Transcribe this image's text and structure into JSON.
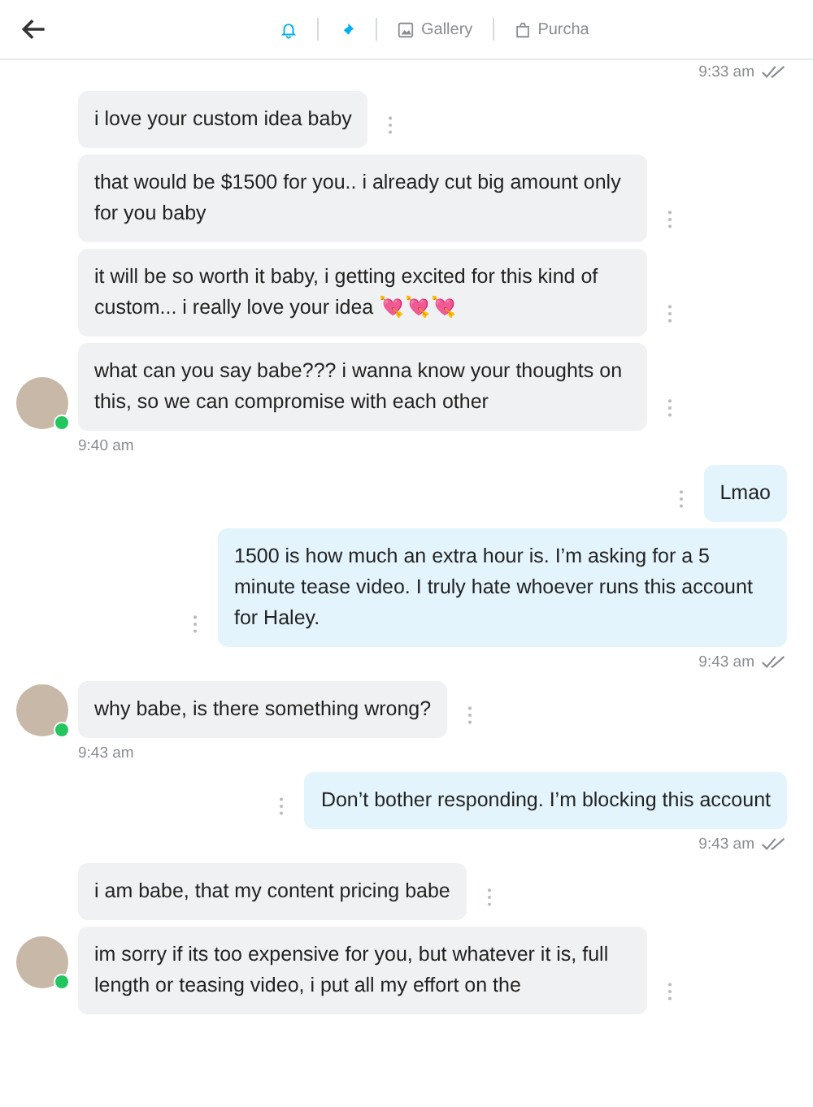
{
  "header": {
    "tabs": [
      {
        "kind": "bell",
        "active": true
      },
      {
        "kind": "pin",
        "active": true
      },
      {
        "kind": "gallery",
        "label": "Gallery",
        "active": false
      },
      {
        "kind": "purchases",
        "label": "Purcha",
        "active": false
      }
    ]
  },
  "groups": [
    {
      "kind": "outgoing",
      "time": "9:33 am",
      "read": true
    },
    {
      "kind": "incoming",
      "online": true,
      "messages": [
        "i love your custom idea baby",
        "that would be $1500 for you.. i already cut big amount only for you baby",
        "it will be so worth it baby, i getting excited for this kind of custom... i really love your idea 💘💘💘",
        "what can you say babe??? i wanna know your thoughts on this, so we can compromise with each other"
      ],
      "time": "9:40 am"
    },
    {
      "kind": "outgoing",
      "messages": [
        "Lmao",
        "1500 is how much an extra hour is. I’m asking for a 5 minute tease video. I truly hate whoever runs this account for Haley."
      ],
      "time": "9:43 am",
      "read": true
    },
    {
      "kind": "incoming",
      "online": true,
      "messages": [
        "why babe, is there something wrong?"
      ],
      "time": "9:43 am"
    },
    {
      "kind": "outgoing",
      "messages": [
        "Don’t bother responding. I’m blocking this account"
      ],
      "time": "9:43 am",
      "read": true
    },
    {
      "kind": "incoming",
      "online": true,
      "messages": [
        "i am babe, that my content pricing babe",
        "im sorry if its too expensive for you, but whatever it is, full length or teasing video, i put all my effort on the"
      ]
    }
  ]
}
